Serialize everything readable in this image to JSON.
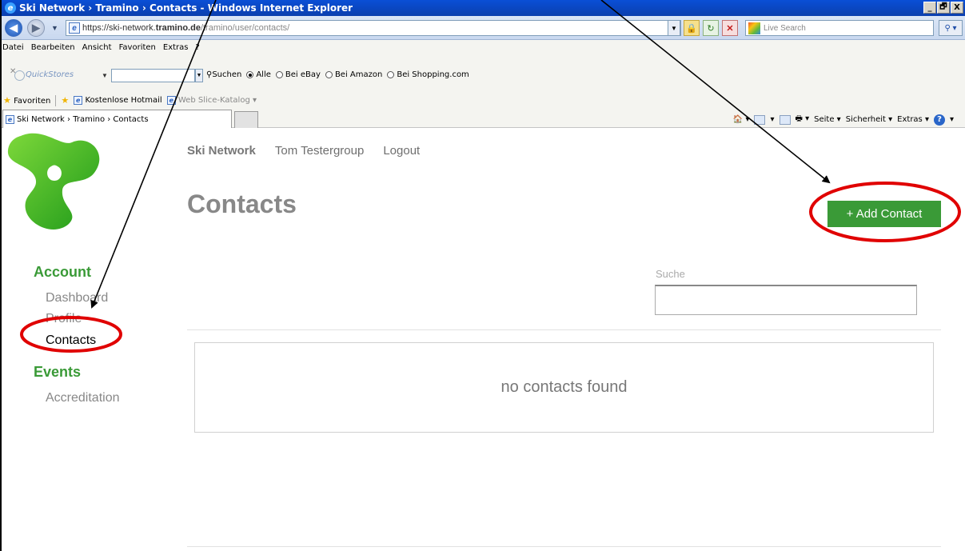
{
  "browser": {
    "window_title": "Ski Network › Tramino › Contacts - Windows Internet Explorer",
    "window_buttons": [
      "_",
      "🗗",
      "X"
    ],
    "url_prefix": "https://ski-network.",
    "url_host": "tramino.de",
    "url_path": "/tramino/user/contacts/",
    "search_placeholder": "Live Search",
    "menu": [
      "Datei",
      "Bearbeiten",
      "Ansicht",
      "Favoriten",
      "Extras",
      "?"
    ],
    "quickstores": {
      "label": "QuickStores",
      "search_label": "Suchen",
      "options": [
        "Alle",
        "Bei eBay",
        "Bei Amazon",
        "Bei Shopping.com"
      ],
      "selected": "Alle"
    },
    "favorites": {
      "label": "Favoriten",
      "links": [
        "Kostenlose Hotmail",
        "Web Slice-Katalog"
      ]
    },
    "tab_title": "Ski Network › Tramino › Contacts",
    "commands": [
      "Seite",
      "Sicherheit",
      "Extras"
    ]
  },
  "site": {
    "topnav": {
      "brand": "Ski Network",
      "user": "Tom Testergroup",
      "logout": "Logout"
    },
    "page_title": "Contacts",
    "add_button": "+ Add Contact",
    "search_label": "Suche",
    "empty_message": "no contacts found",
    "sidebar": {
      "account_heading": "Account",
      "account_items": [
        "Dashboard",
        "Profile",
        "Contacts"
      ],
      "events_heading": "Events",
      "events_items": [
        "Accreditation"
      ]
    }
  },
  "colors": {
    "brand_green": "#3a9a37",
    "annotation_red": "#e00000",
    "ie_blue": "#0b4ad0"
  }
}
